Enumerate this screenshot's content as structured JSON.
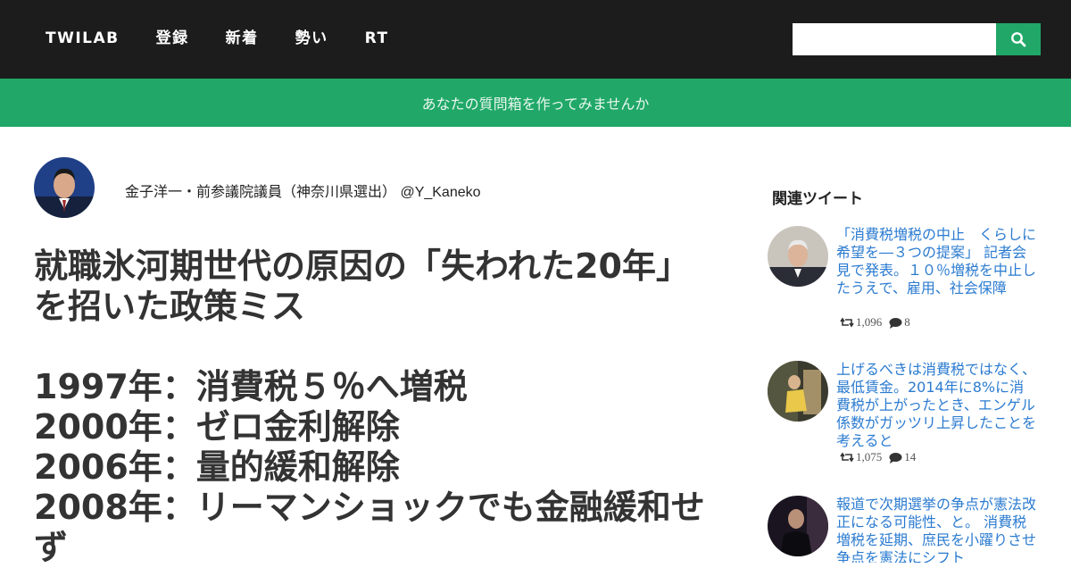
{
  "nav": {
    "brand": "TWILAB",
    "items": [
      "登録",
      "新着",
      "勢い",
      "RT"
    ]
  },
  "search": {
    "value": "",
    "placeholder": "",
    "icon": "search-icon"
  },
  "banner": {
    "text": "あなたの質問箱を作ってみませんか"
  },
  "author": {
    "display": "金子洋一・前参議院議員（神奈川県選出） @Y_Kaneko"
  },
  "tweet": {
    "text": "就職氷河期世代の原因の「失われた20年」\nを招いた政策ミス\n\n1997年：消費税５％へ増税\n2000年：ゼロ金利解除\n2006年：量的緩和解除\n2008年：リーマンショックでも金融緩和せ\nず"
  },
  "related": {
    "title": "関連ツイート",
    "items": [
      {
        "text": "「消費税増税の中止　くらしに希望を―３つの提案」 記者会見で発表。１０％増税を中止したうえで、雇用、社会保障",
        "retweets": "1,096",
        "replies": "8"
      },
      {
        "text": "上げるべきは消費税ではなく、最低賃金。2014年に8%に消費税が上がったとき、エンゲル係数がガッツリ上昇したことを考えると",
        "retweets": "1,075",
        "replies": "14"
      },
      {
        "text": "報道で次期選挙の争点が憲法改正になる可能性、と。 消費税増税を延期、庶民を小躍りさせ争点を憲法にシフト"
      }
    ]
  },
  "colors": {
    "topbar": "#1c1c1c",
    "accent": "#21a868",
    "link": "#2b7bd0"
  }
}
